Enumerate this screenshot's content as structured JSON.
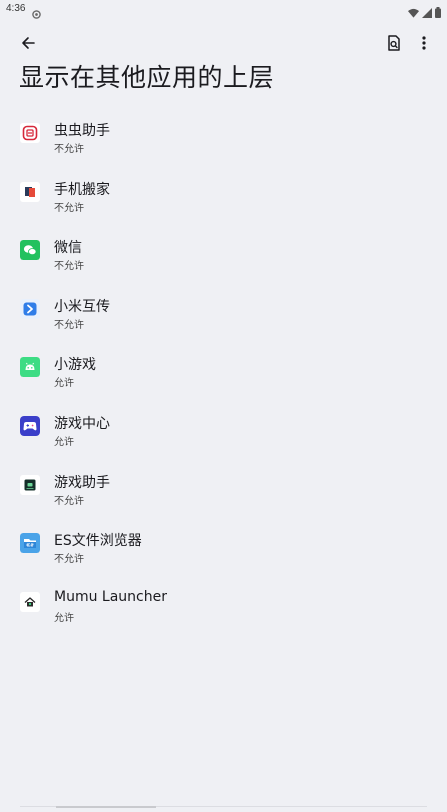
{
  "status_bar": {
    "time": "4:36"
  },
  "header": {
    "title": "显示在其他应用的上层"
  },
  "apps": [
    {
      "name": "虫虫助手",
      "status": "不允许",
      "icon": "chongchong-app-icon"
    },
    {
      "name": "手机搬家",
      "status": "不允许",
      "icon": "phone-transfer-app-icon"
    },
    {
      "name": "微信",
      "status": "不允许",
      "icon": "wechat-app-icon"
    },
    {
      "name": "小米互传",
      "status": "不允许",
      "icon": "mi-share-app-icon"
    },
    {
      "name": "小游戏",
      "status": "允许",
      "icon": "android-app-icon"
    },
    {
      "name": "游戏中心",
      "status": "允许",
      "icon": "gamepad-app-icon"
    },
    {
      "name": "游戏助手",
      "status": "不允许",
      "icon": "game-assistant-app-icon"
    },
    {
      "name": "ES文件浏览器",
      "status": "不允许",
      "icon": "es-file-explorer-app-icon"
    },
    {
      "name": "Mumu Launcher",
      "status": "允许",
      "icon": "mumu-launcher-app-icon"
    }
  ],
  "colors": {
    "background": "#eff0f4",
    "text": "#1b1b1f",
    "wechat": "#22c15e",
    "mi_share": "#2f7de8",
    "android": "#3ddc84",
    "game_center": "#3b3fc9"
  }
}
